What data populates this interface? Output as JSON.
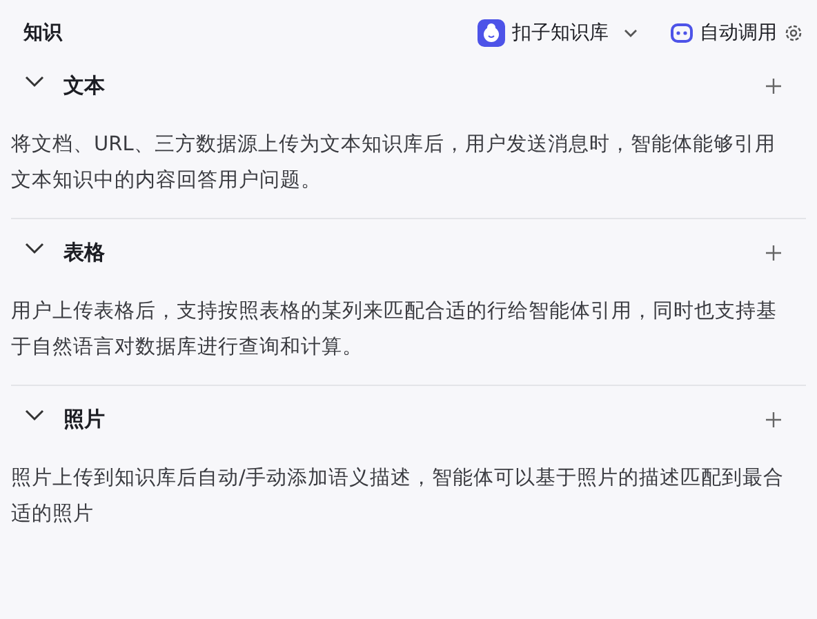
{
  "header": {
    "title": "知识",
    "source": "扣子知识库",
    "mode": "自动调用"
  },
  "sections": [
    {
      "title": "文本",
      "expanded": true,
      "description": "将文档、URL、三方数据源上传为文本知识库后，用户发送消息时，智能体能够引用文本知识中的内容回答用户问题。"
    },
    {
      "title": "表格",
      "expanded": true,
      "description": "用户上传表格后，支持按照表格的某列来匹配合适的行给智能体引用，同时也支持基于自然语言对数据库进行查询和计算。"
    },
    {
      "title": "照片",
      "expanded": true,
      "description": "照片上传到知识库后自动/手动添加语义描述，智能体可以基于照片的描述匹配到最合适的照片"
    }
  ]
}
